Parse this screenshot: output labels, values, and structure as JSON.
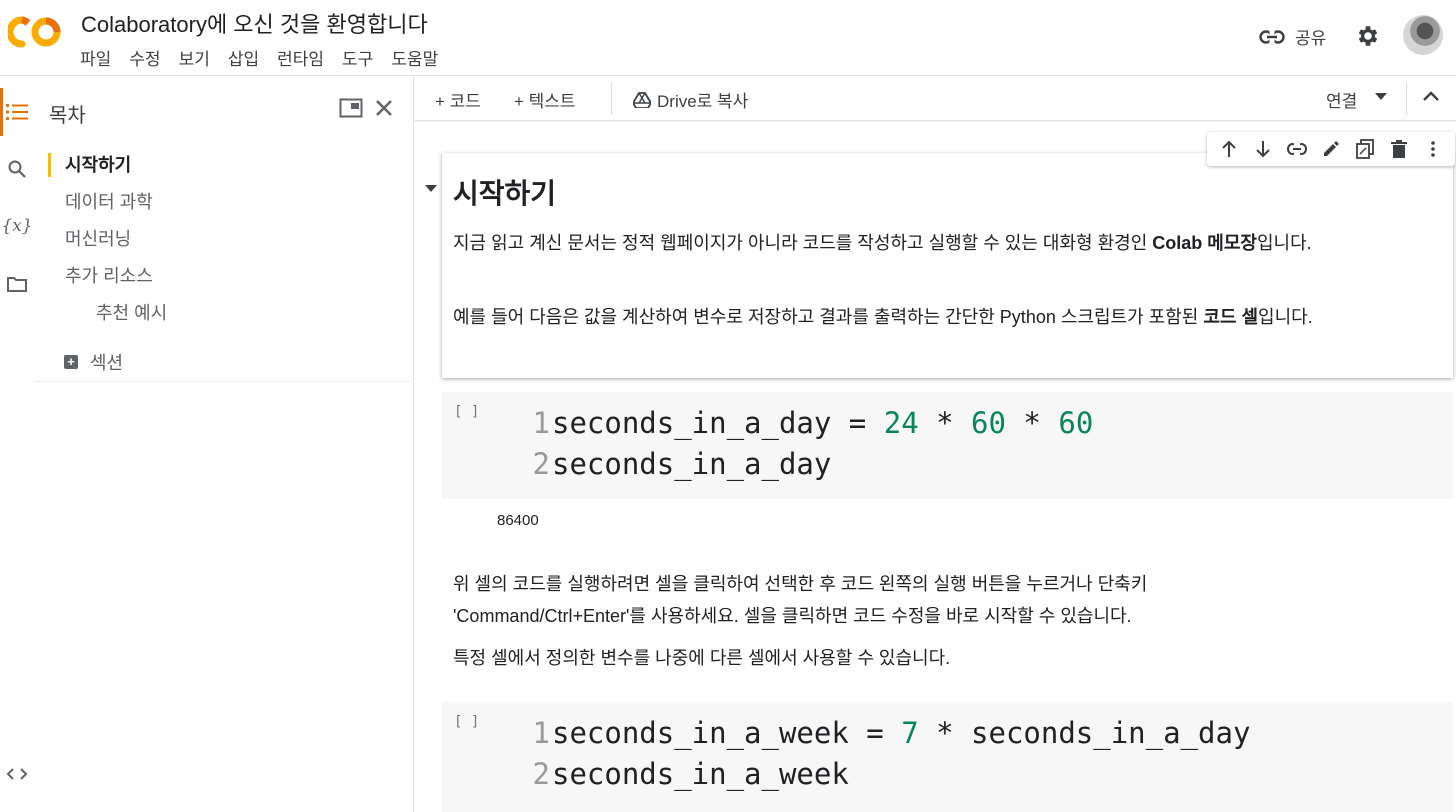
{
  "header": {
    "title": "Colaboratory에 오신 것을 환영합니다",
    "menu": [
      "파일",
      "수정",
      "보기",
      "삽입",
      "런타임",
      "도구",
      "도움말"
    ],
    "share_label": "공유"
  },
  "toc": {
    "title": "목차",
    "items": [
      {
        "label": "시작하기",
        "level": 1,
        "active": true
      },
      {
        "label": "데이터 과학",
        "level": 1
      },
      {
        "label": "머신러닝",
        "level": 1
      },
      {
        "label": "추가 리소스",
        "level": 1
      },
      {
        "label": "추천 예시",
        "level": 2
      }
    ],
    "section_label": "섹션"
  },
  "toolbar": {
    "add_code": "+ 코드",
    "add_text": "+ 텍스트",
    "copy_drive": "Drive로 복사",
    "connect": "연결"
  },
  "notebook": {
    "heading": "시작하기",
    "para1_a": "지금 읽고 계신 문서는 정적 웹페이지가 아니라 코드를 작성하고 실행할 수 있는 대화형 환경인 ",
    "para1_b": "Colab 메모장",
    "para1_c": "입니다.",
    "para2_a": "예를 들어 다음은 값을 계산하여 변수로 저장하고 결과를 출력하는 간단한 Python 스크립트가 포함된 ",
    "para2_b": "코드 셀",
    "para2_c": "입니다.",
    "code1": {
      "bracket": "[ ]",
      "line1_num": "1",
      "line1_a": "seconds_in_a_day = ",
      "line1_n1": "24",
      "line1_op1": " * ",
      "line1_n2": "60",
      "line1_op2": " * ",
      "line1_n3": "60",
      "line2_num": "2",
      "line2": "seconds_in_a_day",
      "output": "86400"
    },
    "para3": "위 셀의 코드를 실행하려면 셀을 클릭하여 선택한 후 코드 왼쪽의 실행 버튼을 누르거나 단축키 'Command/Ctrl+Enter'를 사용하세요. 셀을 클릭하면 코드 수정을 바로 시작할 수 있습니다.",
    "para4": "특정 셀에서 정의한 변수를 나중에 다른 셀에서 사용할 수 있습니다.",
    "code2": {
      "bracket": "[ ]",
      "line1_num": "1",
      "line1_a": "seconds_in_a_week = ",
      "line1_n1": "7",
      "line1_b": " * seconds_in_a_day",
      "line2_num": "2",
      "line2": "seconds_in_a_week"
    }
  },
  "colors": {
    "accent_orange": "#e8710a",
    "accent_yellow": "#fbbc04",
    "number_green": "#098658"
  }
}
